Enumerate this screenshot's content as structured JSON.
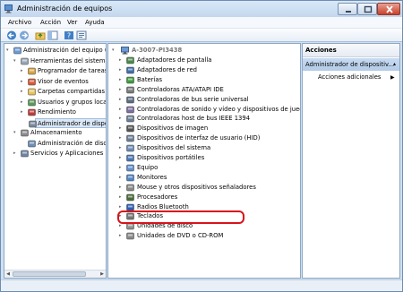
{
  "window": {
    "title": "Administración de equipos"
  },
  "menubar": [
    "Archivo",
    "Acción",
    "Ver",
    "Ayuda"
  ],
  "toolbar": {
    "icons": [
      "back-icon",
      "forward-icon",
      "up-folder-icon",
      "show-tree-icon",
      "help-icon",
      "properties-icon"
    ]
  },
  "left_tree": [
    {
      "label": "Administración del equipo (loc",
      "icon": "computer-management-icon",
      "level": 0,
      "expander": "▾"
    },
    {
      "label": "Herramientas del sistema",
      "icon": "tools-icon",
      "level": 1,
      "expander": "▾"
    },
    {
      "label": "Programador de tareas",
      "icon": "clock-icon",
      "level": 2,
      "expander": "▸"
    },
    {
      "label": "Visor de eventos",
      "icon": "event-viewer-icon",
      "level": 2,
      "expander": "▸"
    },
    {
      "label": "Carpetas compartidas",
      "icon": "shared-folder-icon",
      "level": 2,
      "expander": "▸"
    },
    {
      "label": "Usuarios y grupos locale",
      "icon": "users-icon",
      "level": 2,
      "expander": "▸"
    },
    {
      "label": "Rendimiento",
      "icon": "performance-icon",
      "level": 2,
      "expander": "▸"
    },
    {
      "label": "Administrador de dispo",
      "icon": "device-manager-icon",
      "level": 2,
      "expander": "",
      "selected": true
    },
    {
      "label": "Almacenamiento",
      "icon": "storage-icon",
      "level": 1,
      "expander": "▾"
    },
    {
      "label": "Administración de disco",
      "icon": "disk-management-icon",
      "level": 2,
      "expander": ""
    },
    {
      "label": "Servicios y Aplicaciones",
      "icon": "services-icon",
      "level": 1,
      "expander": "▸"
    }
  ],
  "device_tree": {
    "root_label": "A-3007-PI3438",
    "categories": [
      {
        "label": "Adaptadores de pantalla",
        "icon": "display-adapter-icon"
      },
      {
        "label": "Adaptadores de red",
        "icon": "network-adapter-icon"
      },
      {
        "label": "Baterías",
        "icon": "battery-icon"
      },
      {
        "label": "Controladoras ATA/ATAPI IDE",
        "icon": "ide-controller-icon"
      },
      {
        "label": "Controladoras de bus serie universal",
        "icon": "usb-controller-icon"
      },
      {
        "label": "Controladoras de sonido y vídeo y dispositivos de juego",
        "icon": "sound-icon"
      },
      {
        "label": "Controladoras host de bus IEEE 1394",
        "icon": "ieee1394-icon"
      },
      {
        "label": "Dispositivos de imagen",
        "icon": "camera-icon"
      },
      {
        "label": "Dispositivos de interfaz de usuario (HID)",
        "icon": "hid-icon"
      },
      {
        "label": "Dispositivos del sistema",
        "icon": "system-device-icon"
      },
      {
        "label": "Dispositivos portátiles",
        "icon": "portable-device-icon"
      },
      {
        "label": "Equipo",
        "icon": "computer-icon"
      },
      {
        "label": "Monitores",
        "icon": "monitor-icon"
      },
      {
        "label": "Mouse y otros dispositivos señaladores",
        "icon": "mouse-icon"
      },
      {
        "label": "Procesadores",
        "icon": "processor-icon"
      },
      {
        "label": "Radios Bluetooth",
        "icon": "bluetooth-icon"
      },
      {
        "label": "Teclados",
        "icon": "keyboard-icon"
      },
      {
        "label": "Unidades de disco",
        "icon": "disk-drive-icon",
        "highlighted": true
      },
      {
        "label": "Unidades de DVD o CD-ROM",
        "icon": "dvd-drive-icon"
      }
    ]
  },
  "actions_pane": {
    "header": "Acciones",
    "section": "Administrador de dispositiv...",
    "more_actions": "Acciones adicionales"
  },
  "colors": {
    "highlight": "#d8131b",
    "selection": "#dbe7f5",
    "frame": "#cfe0f1"
  }
}
